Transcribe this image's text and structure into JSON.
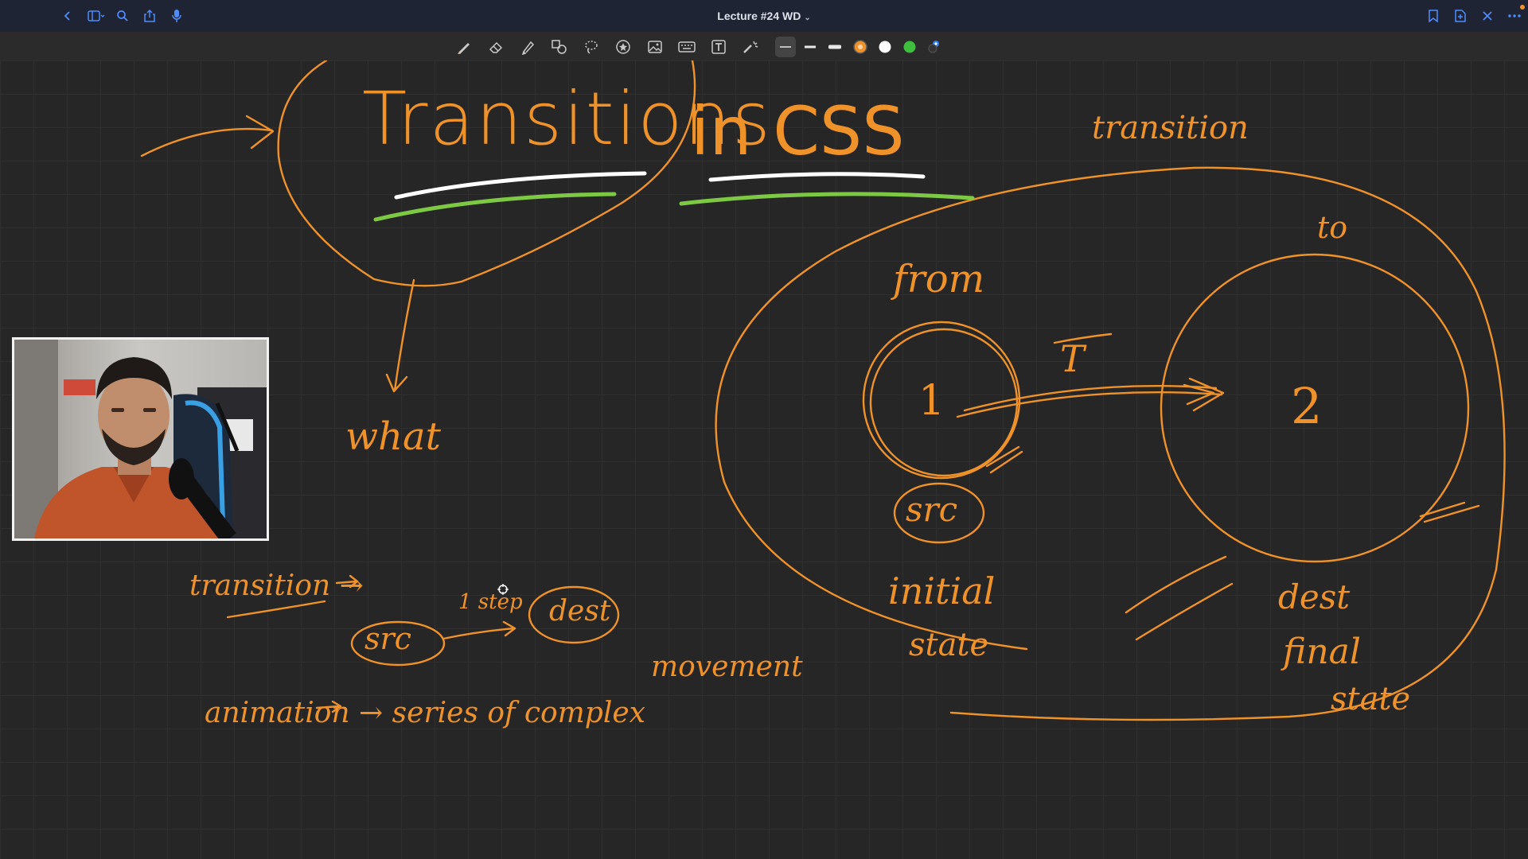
{
  "window": {
    "title": "Lecture #24 WD",
    "title_chevron": "⌄"
  },
  "colors": {
    "ink_orange": "#f0922a",
    "ink_white": "#ffffff",
    "ink_green": "#7ec943",
    "accent": "#4f8dff",
    "canvas_bg": "#262626"
  },
  "toolbar": {
    "tools": [
      "pen-icon",
      "eraser-icon",
      "highlighter-icon",
      "shapes-icon",
      "lasso-icon",
      "sticker-icon",
      "image-icon",
      "keyboard-icon",
      "text-box-icon",
      "laser-pointer-icon"
    ],
    "stroke_widths": [
      "thin",
      "medium",
      "thick"
    ],
    "selected_stroke": "thin",
    "swatches": [
      "#f0922a",
      "#ffffff",
      "#3dbe3d"
    ],
    "selected_swatch": "#f0922a"
  },
  "notes": {
    "title_word_1": "Transitions",
    "title_word_2": "in CSS",
    "transition_top_right": "transition",
    "what": "what",
    "transition_left": "transition →",
    "src_small": "src",
    "one_step": "1 step",
    "dest_small": "dest",
    "animation_line_1": "animation → series of complex",
    "animation_line_2": "movement",
    "from": "from",
    "to": "to",
    "state_1": "1",
    "state_2": "2",
    "T": "T",
    "src_big": "src",
    "initial": "initial",
    "state_word": "state",
    "dest_big": "dest",
    "final": "final",
    "final_state": "state"
  }
}
